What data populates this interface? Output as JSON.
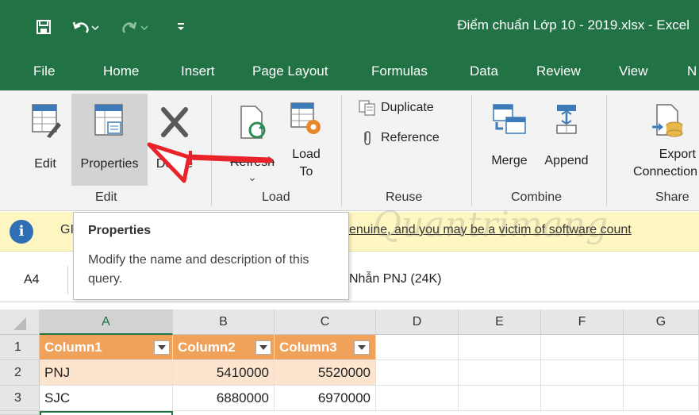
{
  "title": "Điểm chuẩn Lớp 10 - 2019.xlsx  -  Excel",
  "qat": {
    "save": "save-icon",
    "undo": "undo-icon",
    "redo": "redo-icon",
    "customize": "customize-icon"
  },
  "menu": {
    "tabs": [
      "File",
      "Home",
      "Insert",
      "Page Layout",
      "Formulas",
      "Data",
      "Review",
      "View",
      "N"
    ]
  },
  "ribbon": {
    "edit_group": {
      "label": "Edit",
      "edit_btn": "Edit",
      "properties_btn": "Properties",
      "delete_btn": "Delete"
    },
    "load_group": {
      "label": "Load",
      "refresh_btn": "Refresh",
      "refresh_arrow": "⌄",
      "load_to_line1": "Load",
      "load_to_line2": "To"
    },
    "reuse_group": {
      "label": "Reuse",
      "duplicate": "Duplicate",
      "reference": "Reference"
    },
    "combine_group": {
      "label": "Combine",
      "merge": "Merge",
      "append": "Append"
    },
    "share_group": {
      "label": "Share",
      "export_line1": "Export",
      "export_line2": "Connection"
    }
  },
  "infobar": {
    "prefix": "GI",
    "message": "enuine, and you may be a victim of software count"
  },
  "tooltip": {
    "title": "Properties",
    "description": "Modify the name and description of this query."
  },
  "formula_bar": {
    "namebox": "A4",
    "content": "Nhẫn PNJ (24K)"
  },
  "grid": {
    "columns": [
      "A",
      "B",
      "C",
      "D",
      "E",
      "F",
      "G"
    ],
    "rows": [
      {
        "num": "1",
        "cells": [
          "Column1",
          "Column2",
          "Column3"
        ]
      },
      {
        "num": "2",
        "cells": [
          "PNJ",
          "5410000",
          "5520000"
        ]
      },
      {
        "num": "3",
        "cells": [
          "SJC",
          "6880000",
          "6970000"
        ]
      }
    ]
  },
  "watermark": "Quantrimang",
  "colors": {
    "excel_green": "#217346",
    "table_header": "#f0a25a",
    "table_band": "#fde4cf",
    "arrow_red": "#e8232a",
    "info_bar": "#fff7c2"
  }
}
